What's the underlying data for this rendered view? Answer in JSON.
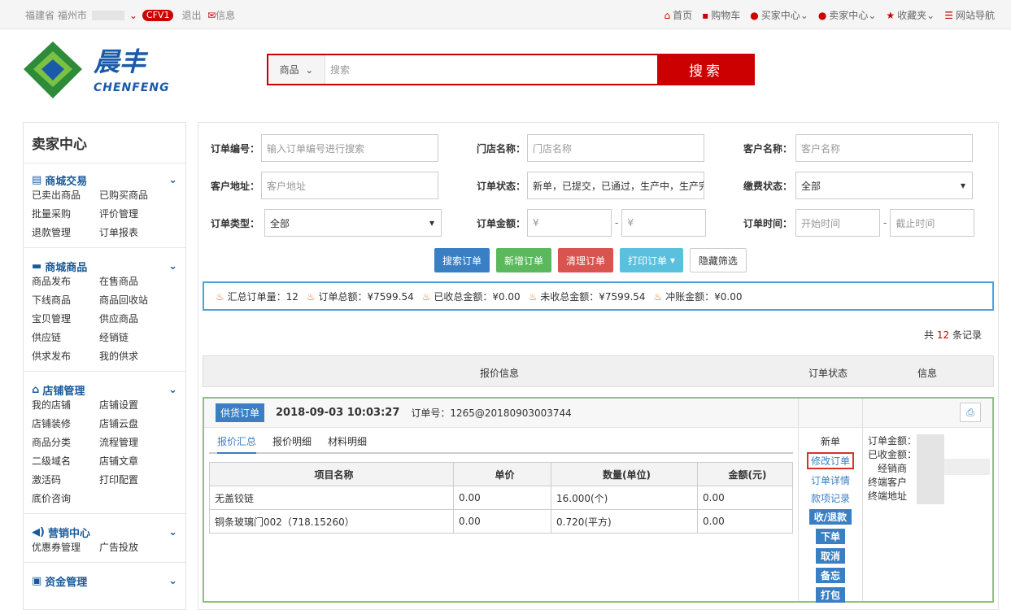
{
  "topbar": {
    "province": "福建省",
    "city": "福州市",
    "badge": "CFV1",
    "logout": "退出",
    "messages": "信息",
    "home": "首页",
    "cart": "购物车",
    "buyer": "买家中心",
    "seller": "卖家中心",
    "favorites": "收藏夹",
    "sitenav": "网站导航"
  },
  "logo": {
    "cn": "晨丰",
    "en": "CHENFENG"
  },
  "search": {
    "category": "商品",
    "placeholder": "搜索",
    "button": "搜索"
  },
  "sidebar": {
    "title": "卖家中心",
    "groups": [
      {
        "title": "商城交易",
        "items": [
          "已卖出商品",
          "已购买商品",
          "批量采购",
          "评价管理",
          "退款管理",
          "订单报表"
        ]
      },
      {
        "title": "商城商品",
        "items": [
          "商品发布",
          "在售商品",
          "下线商品",
          "商品回收站",
          "宝贝管理",
          "供应商品",
          "供应链",
          "经销链",
          "供求发布",
          "我的供求"
        ]
      },
      {
        "title": "店铺管理",
        "items": [
          "我的店铺",
          "店铺设置",
          "店铺装修",
          "店铺云盘",
          "商品分类",
          "流程管理",
          "二级域名",
          "店铺文章",
          "激活码",
          "打印配置",
          "底价咨询"
        ]
      },
      {
        "title": "营销中心",
        "items": [
          "优惠券管理",
          "广告投放"
        ]
      },
      {
        "title": "资金管理",
        "items": []
      }
    ]
  },
  "filters": {
    "order_no_label": "订单编号：",
    "order_no_ph": "输入订单编号进行搜索",
    "store_label": "门店名称：",
    "store_ph": "门店名称",
    "customer_label": "客户名称：",
    "customer_ph": "客户名称",
    "address_label": "客户地址：",
    "address_ph": "客户地址",
    "status_label": "订单状态：",
    "status_value": "新单，已提交，已通过，生产中，生产完成",
    "pay_label": "缴费状态：",
    "pay_value": "全部",
    "type_label": "订单类型：",
    "type_value": "全部",
    "amount_label": "订单金额：",
    "amount_ph": "¥",
    "time_label": "订单时间：",
    "start_ph": "开始时间",
    "end_ph": "截止时间",
    "dash": "-"
  },
  "buttons": {
    "search": "搜索订单",
    "add": "新增订单",
    "clear": "清理订单",
    "print": "打印订单",
    "hide": "隐藏筛选"
  },
  "summary": {
    "total_orders": "汇总订单量：12",
    "total_amount": "订单总额：¥7599.54",
    "received": "已收总金额：¥0.00",
    "unreceived": "未收总金额：¥7599.54",
    "offset": "冲账金额：¥0.00"
  },
  "count": {
    "prefix": "共",
    "num": "12",
    "suffix": "条记录"
  },
  "table_head": {
    "quote": "报价信息",
    "status": "订单状态",
    "info": "信息"
  },
  "order": {
    "tag": "供货订单",
    "date": "2018-09-03 10:03:27",
    "order_no": "订单号：1265@20180903003744",
    "tabs": [
      "报价汇总",
      "报价明细",
      "材料明细"
    ],
    "columns": [
      "项目名称",
      "单价",
      "数量(单位)",
      "金额(元)"
    ],
    "rows": [
      [
        "无盖铰链",
        "0.00",
        "16.000(个)",
        "0.00"
      ],
      [
        "铜条玻璃门002（718.15260）",
        "0.00",
        "0.720(平方)",
        "0.00"
      ]
    ],
    "status": "新单",
    "links": [
      "修改订单",
      "订单详情",
      "款项记录"
    ],
    "buttons": [
      "收/退款",
      "下单",
      "取消",
      "备忘",
      "打包"
    ],
    "info": [
      "订单金额：",
      "已收金额：",
      "经销商",
      "终端客户",
      "终端地址"
    ]
  },
  "colors": {
    "brand_red": "#cc0000",
    "blue": "#3a7fc4"
  }
}
